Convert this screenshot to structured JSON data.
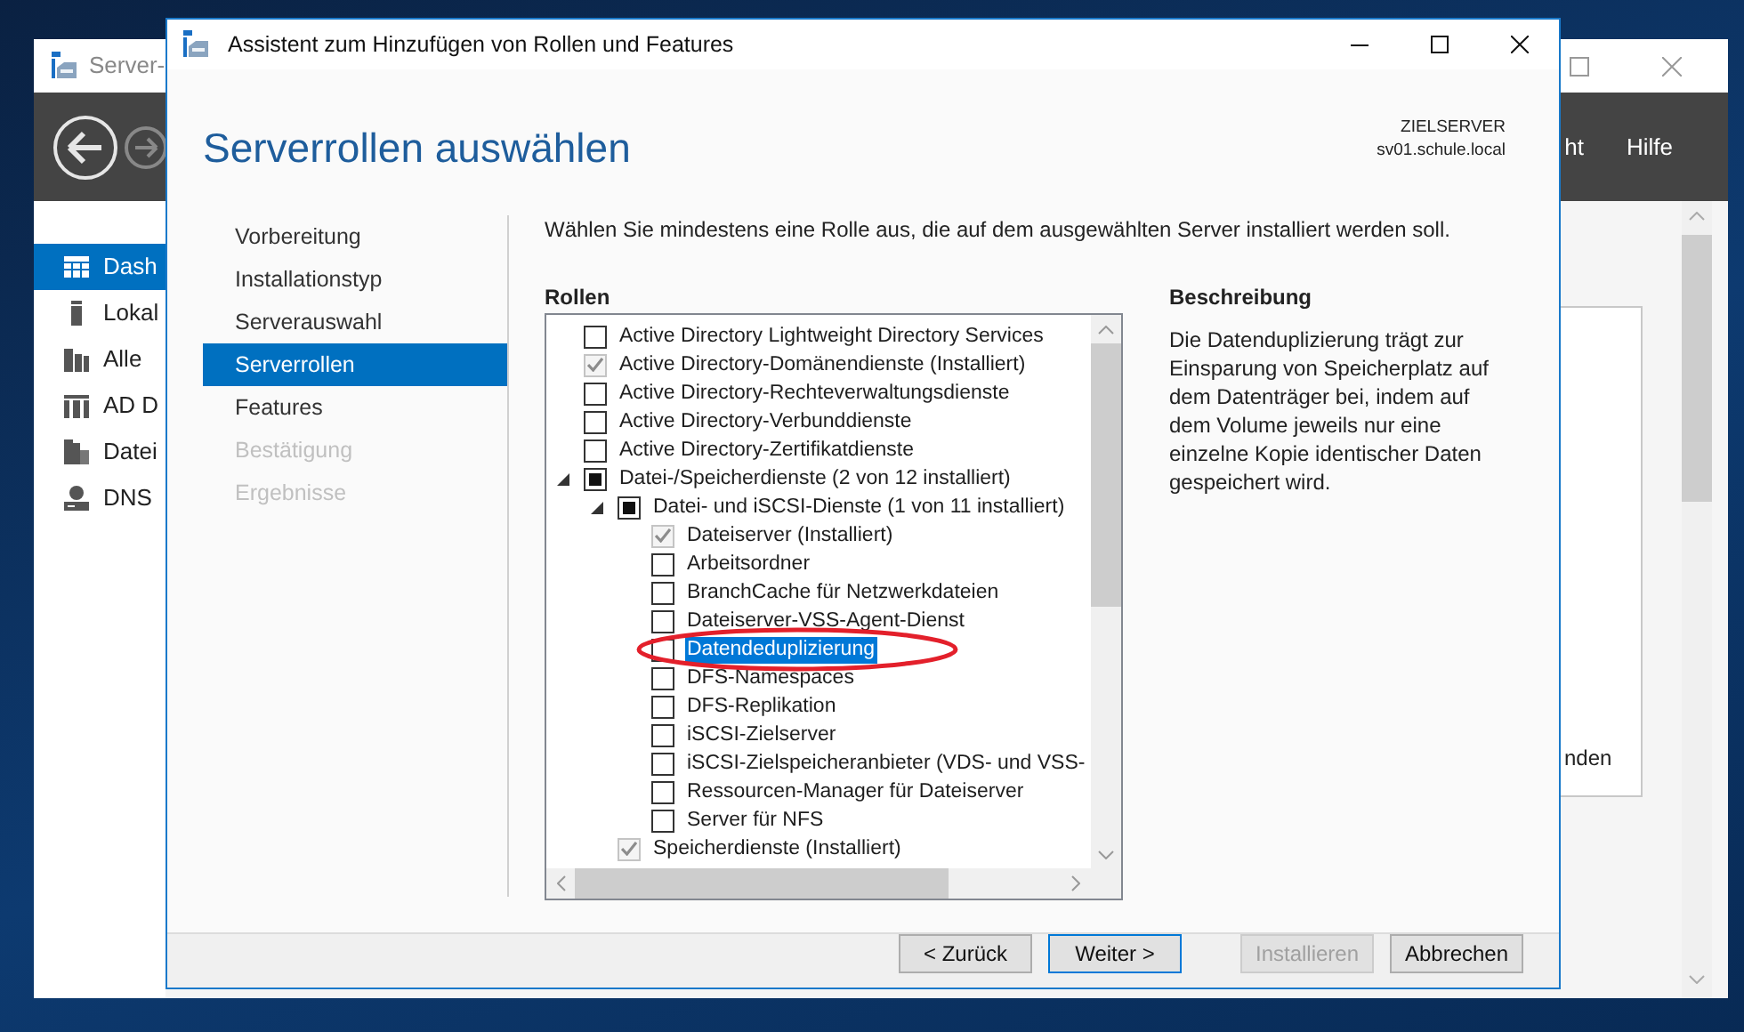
{
  "background_window": {
    "title": "Server-",
    "menu": [
      {
        "label": "ht"
      },
      {
        "label": "Hilfe"
      }
    ],
    "sidebar": {
      "items": [
        {
          "label": "Dash",
          "selected": true
        },
        {
          "label": "Lokal",
          "selected": false
        },
        {
          "label": "Alle",
          "selected": false
        },
        {
          "label": "AD D",
          "selected": false
        },
        {
          "label": "Datei",
          "selected": false
        },
        {
          "label": "DNS",
          "selected": false
        }
      ]
    },
    "panel_text": "nden"
  },
  "wizard": {
    "title": "Assistent zum Hinzufügen von Rollen und Features",
    "heading": "Serverrollen auswählen",
    "target": {
      "label": "ZIELSERVER",
      "server": "sv01.schule.local"
    },
    "steps": [
      {
        "label": "Vorbereitung",
        "selected": false,
        "disabled": false
      },
      {
        "label": "Installationstyp",
        "selected": false,
        "disabled": false
      },
      {
        "label": "Serverauswahl",
        "selected": false,
        "disabled": false
      },
      {
        "label": "Serverrollen",
        "selected": true,
        "disabled": false
      },
      {
        "label": "Features",
        "selected": false,
        "disabled": false
      },
      {
        "label": "Bestätigung",
        "selected": false,
        "disabled": true
      },
      {
        "label": "Ergebnisse",
        "selected": false,
        "disabled": true
      }
    ],
    "instruction": "Wählen Sie mindestens eine Rolle aus, die auf dem ausgewählten Server installiert werden soll.",
    "roles": {
      "label": "Rollen",
      "items": [
        {
          "label": "Active Directory Lightweight Directory Services",
          "checked": false,
          "partial": false,
          "disabled": false,
          "selected": false
        },
        {
          "label": "Active Directory-Domänendienste (Installiert)",
          "checked": true,
          "partial": false,
          "disabled": true,
          "selected": false
        },
        {
          "label": "Active Directory-Rechteverwaltungsdienste",
          "checked": false,
          "partial": false,
          "disabled": false,
          "selected": false
        },
        {
          "label": "Active Directory-Verbunddienste",
          "checked": false,
          "partial": false,
          "disabled": false,
          "selected": false
        },
        {
          "label": "Active Directory-Zertifikatdienste",
          "checked": false,
          "partial": false,
          "disabled": false,
          "selected": false
        },
        {
          "label": "Datei-/Speicherdienste (2 von 12 installiert)",
          "checked": false,
          "partial": true,
          "disabled": false,
          "selected": false,
          "expanded": true,
          "children": [
            {
              "label": "Datei- und iSCSI-Dienste (1 von 11 installiert)",
              "checked": false,
              "partial": true,
              "disabled": false,
              "selected": false,
              "expanded": true,
              "children": [
                {
                  "label": "Dateiserver (Installiert)",
                  "checked": true,
                  "partial": false,
                  "disabled": true,
                  "selected": false
                },
                {
                  "label": "Arbeitsordner",
                  "checked": false,
                  "partial": false,
                  "disabled": false,
                  "selected": false
                },
                {
                  "label": "BranchCache für Netzwerkdateien",
                  "checked": false,
                  "partial": false,
                  "disabled": false,
                  "selected": false
                },
                {
                  "label": "Dateiserver-VSS-Agent-Dienst",
                  "checked": false,
                  "partial": false,
                  "disabled": false,
                  "selected": false
                },
                {
                  "label": "Datendeduplizierung",
                  "checked": false,
                  "partial": false,
                  "disabled": false,
                  "selected": true
                },
                {
                  "label": "DFS-Namespaces",
                  "checked": false,
                  "partial": false,
                  "disabled": false,
                  "selected": false
                },
                {
                  "label": "DFS-Replikation",
                  "checked": false,
                  "partial": false,
                  "disabled": false,
                  "selected": false
                },
                {
                  "label": "iSCSI-Zielserver",
                  "checked": false,
                  "partial": false,
                  "disabled": false,
                  "selected": false
                },
                {
                  "label": "iSCSI-Zielspeicheranbieter (VDS- und VSS-",
                  "checked": false,
                  "partial": false,
                  "disabled": false,
                  "selected": false
                },
                {
                  "label": "Ressourcen-Manager für Dateiserver",
                  "checked": false,
                  "partial": false,
                  "disabled": false,
                  "selected": false
                },
                {
                  "label": "Server für NFS",
                  "checked": false,
                  "partial": false,
                  "disabled": false,
                  "selected": false
                }
              ]
            },
            {
              "label": "Speicherdienste (Installiert)",
              "checked": true,
              "partial": false,
              "disabled": true,
              "selected": false
            }
          ]
        }
      ]
    },
    "description": {
      "label": "Beschreibung",
      "text": "Die Datenduplizierung trägt zur Einsparung von Speicherplatz auf dem Datenträger bei, indem auf dem Volume jeweils nur eine einzelne Kopie identischer Daten gespeichert wird."
    },
    "buttons": [
      {
        "label": "< Zurück",
        "disabled": false,
        "default": false
      },
      {
        "label": "Weiter >",
        "disabled": false,
        "default": true
      },
      {
        "label": "Installieren",
        "disabled": true,
        "default": false
      },
      {
        "label": "Abbrechen",
        "disabled": false,
        "default": false
      }
    ]
  },
  "annotation": {
    "kind": "ellipse"
  }
}
